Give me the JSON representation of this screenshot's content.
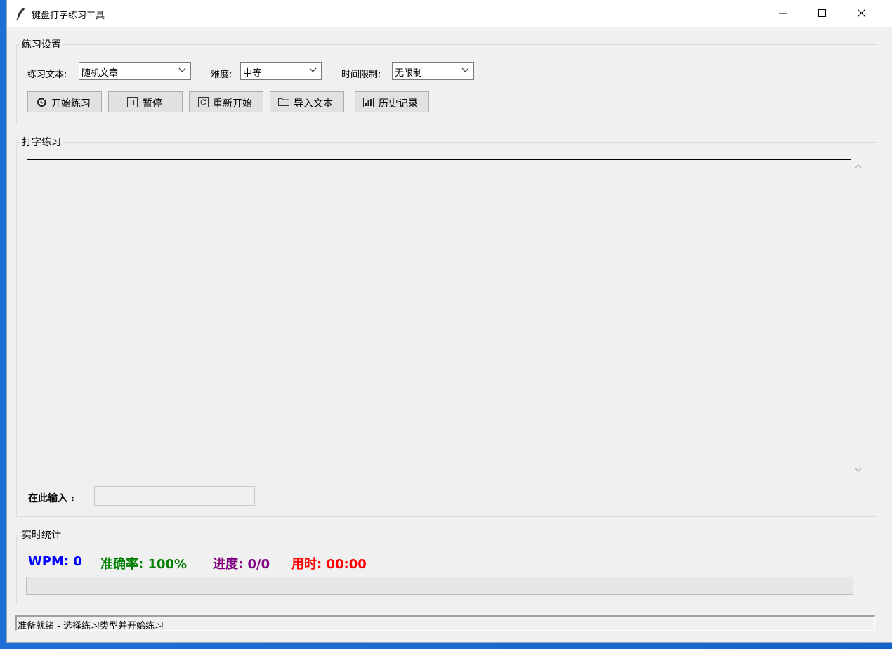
{
  "window": {
    "title": "键盘打字练习工具"
  },
  "settings": {
    "group_label": "练习设置",
    "text_label": "练习文本:",
    "text_value": "随机文章",
    "difficulty_label": "难度:",
    "difficulty_value": "中等",
    "time_label": "时间限制:",
    "time_value": "无限制"
  },
  "toolbar": {
    "start": "开始练习",
    "pause": "暂停",
    "restart": "重新开始",
    "import": "导入文本",
    "history": "历史记录"
  },
  "practice": {
    "group_label": "打字练习",
    "display_text": "",
    "input_label": "在此输入 :",
    "input_value": ""
  },
  "stats": {
    "group_label": "实时统计",
    "wpm": "WPM: 0",
    "accuracy": "准确率: 100%",
    "progress": "进度: 0/0",
    "elapsed": "用时: 00:00",
    "progress_fraction": 0
  },
  "status": {
    "text": "准备就绪 - 选择练习类型并开始练习"
  },
  "colors": {
    "wpm": "#0000ff",
    "accuracy": "#008000",
    "progress": "#800080",
    "elapsed": "#ff0000"
  }
}
